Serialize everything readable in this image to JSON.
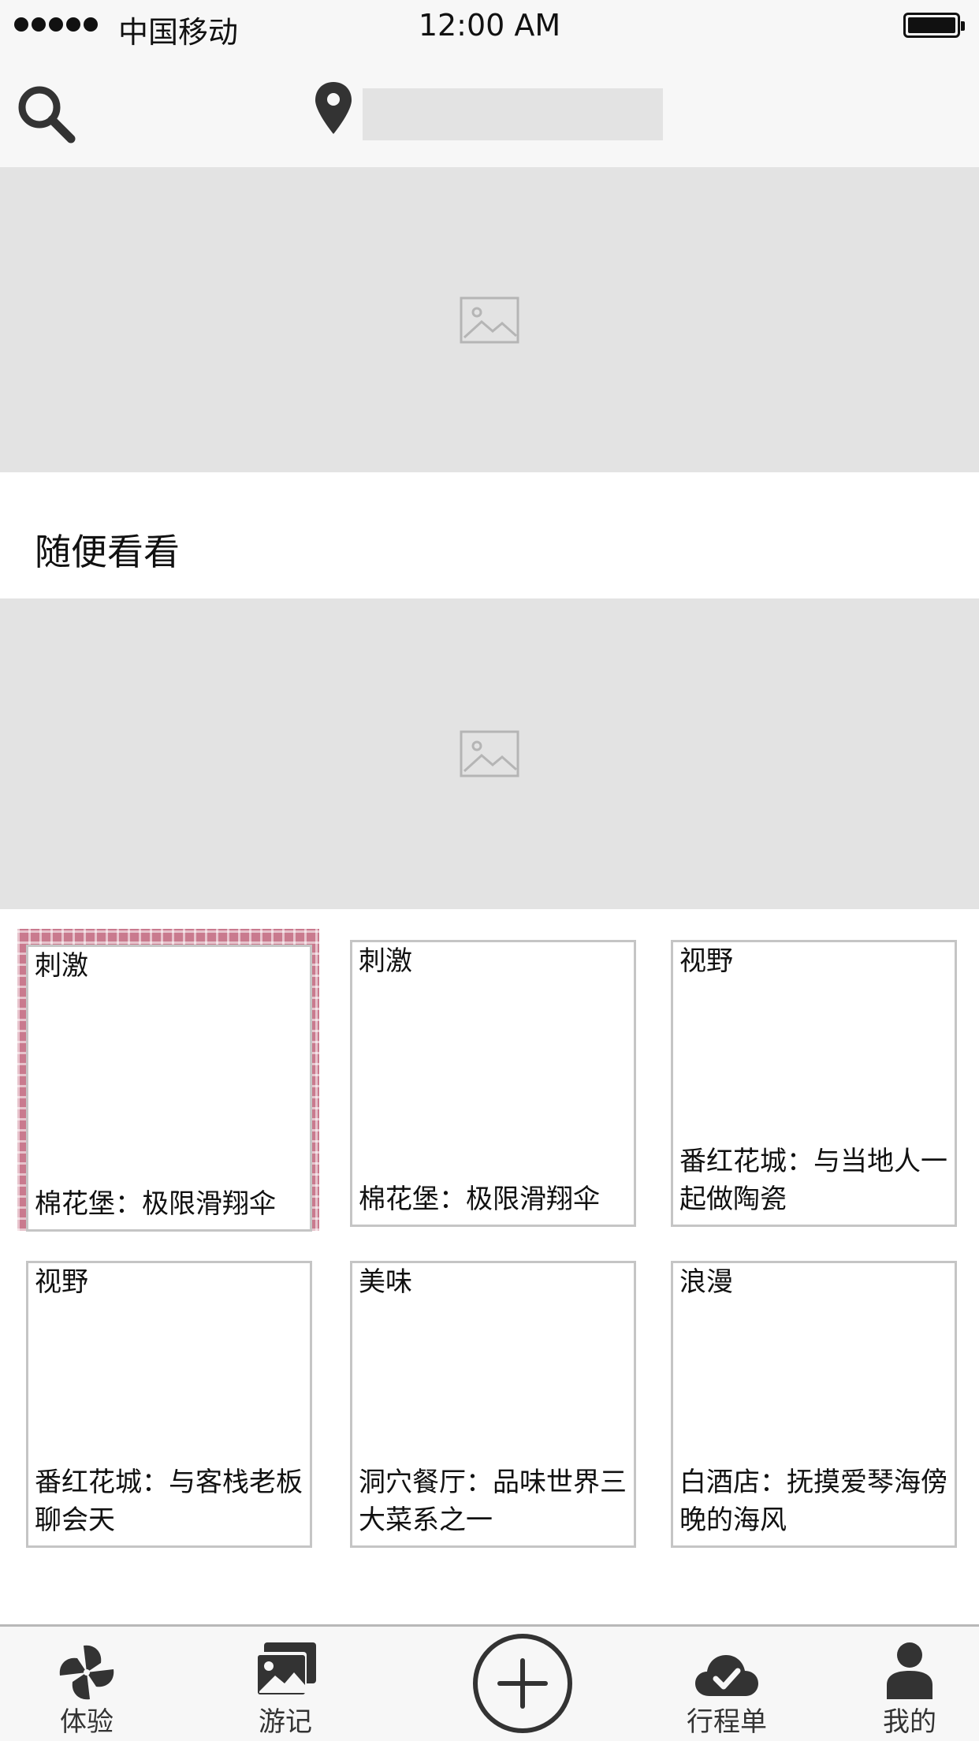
{
  "status_bar": {
    "carrier": "中国移动",
    "time": "12:00 AM"
  },
  "search": {
    "location_value": "",
    "search_icon": "search-icon",
    "location_icon": "map-pin-icon"
  },
  "section": {
    "title": "随便看看"
  },
  "cards": [
    {
      "tag": "刺激",
      "title": "棉花堡：极限滑翔伞"
    },
    {
      "tag": "刺激",
      "title": "棉花堡：极限滑翔伞"
    },
    {
      "tag": "视野",
      "title": "番红花城：与当地人一起做陶瓷"
    },
    {
      "tag": "视野",
      "title": "番红花城：与客栈老板聊会天"
    },
    {
      "tag": "美味",
      "title": "洞穴餐厅：品味世界三大菜系之一"
    },
    {
      "tag": "浪漫",
      "title": "白酒店：抚摸爱琴海傍晚的海风"
    }
  ],
  "tabs": {
    "experience": {
      "label": "体验",
      "icon": "pinwheel-icon"
    },
    "travel_notes": {
      "label": "游记",
      "icon": "photo-album-icon"
    },
    "add": {
      "icon": "plus-circle-icon"
    },
    "itinerary": {
      "label": "行程单",
      "icon": "cloud-check-icon"
    },
    "mine": {
      "label": "我的",
      "icon": "user-icon"
    }
  },
  "colors": {
    "placeholder_gray": "#e3e3e3",
    "bar_background": "#f7f7f7",
    "card_border": "#c5c5c5",
    "icon_dark": "#333333"
  }
}
